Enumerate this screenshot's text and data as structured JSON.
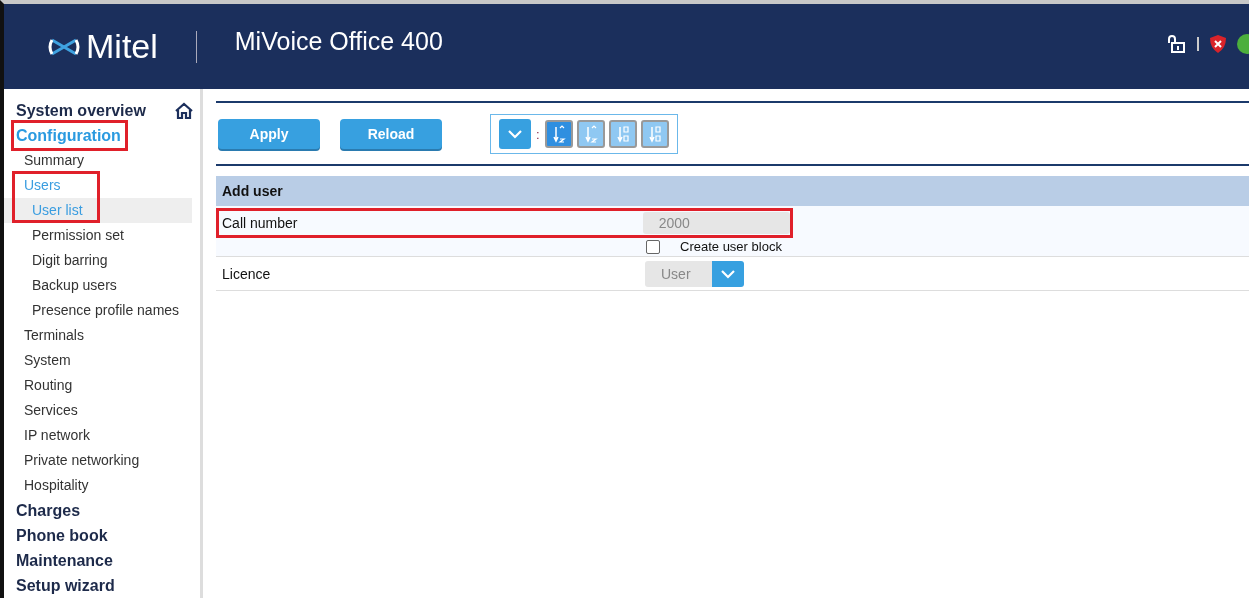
{
  "header": {
    "logo": "Mitel",
    "product": "MiVoice Office 400",
    "status_online": true
  },
  "sidebar": {
    "items": [
      {
        "label": "System overview",
        "kind": "section",
        "selected": false,
        "highlighted": false,
        "home": true
      },
      {
        "label": "Configuration",
        "kind": "section",
        "selected": true,
        "highlighted": true,
        "children": [
          {
            "label": "Summary",
            "selected": false,
            "highlighted": false
          },
          {
            "label": "Users",
            "selected": true,
            "highlighted": true,
            "children": [
              {
                "label": "User list",
                "selected": true
              },
              {
                "label": "Permission set",
                "selected": false
              },
              {
                "label": "Digit barring",
                "selected": false
              },
              {
                "label": "Backup users",
                "selected": false
              },
              {
                "label": "Presence profile names",
                "selected": false
              }
            ]
          },
          {
            "label": "Terminals",
            "selected": false,
            "highlighted": false
          },
          {
            "label": "System",
            "selected": false,
            "highlighted": false
          },
          {
            "label": "Routing",
            "selected": false,
            "highlighted": false
          },
          {
            "label": "Services",
            "selected": false,
            "highlighted": false
          },
          {
            "label": "IP network",
            "selected": false,
            "highlighted": false
          },
          {
            "label": "Private networking",
            "selected": false,
            "highlighted": false
          },
          {
            "label": "Hospitality",
            "selected": false,
            "highlighted": false
          }
        ]
      },
      {
        "label": "Charges",
        "kind": "section",
        "selected": false,
        "highlighted": false
      },
      {
        "label": "Phone book",
        "kind": "section",
        "selected": false,
        "highlighted": false
      },
      {
        "label": "Maintenance",
        "kind": "section",
        "selected": false,
        "highlighted": false
      },
      {
        "label": "Setup wizard",
        "kind": "section",
        "selected": false,
        "highlighted": false
      }
    ]
  },
  "toolbar": {
    "buttons": [
      "Apply",
      "Reload"
    ],
    "separator": ":",
    "sort_buttons": [
      {
        "selected": true
      },
      {
        "selected": false
      },
      {
        "selected": false
      },
      {
        "selected": false
      }
    ]
  },
  "form": {
    "title": "Add user",
    "rows": [
      {
        "label": "Call number",
        "kind": "text",
        "value": "2000",
        "highlighted": true,
        "checkbox": {
          "label": "Create user block",
          "checked": false
        }
      },
      {
        "label": "Licence",
        "kind": "select",
        "value": "User",
        "highlighted": false
      }
    ]
  }
}
